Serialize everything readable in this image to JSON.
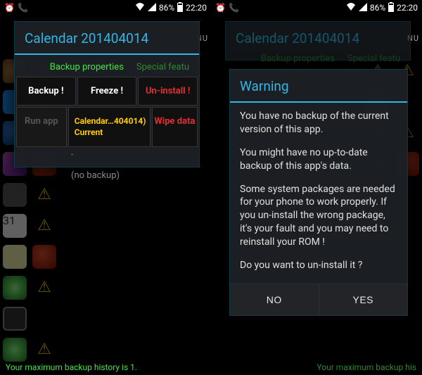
{
  "status": {
    "battery": "86%",
    "time": "22:20"
  },
  "nu_label": "NU",
  "dialog1": {
    "title": "Calendar 201404014",
    "tab_a": "Backup properties",
    "tab_b": "Special featu",
    "btn_backup": "Backup !",
    "btn_freeze": "Freeze !",
    "btn_uninstall": "Un-install !",
    "btn_run": "Run app",
    "current_line1": "Calendar…404014)",
    "current_line2": "Current",
    "btn_wipe": "Wipe data",
    "dash": "-",
    "no_backup": "(no backup)"
  },
  "dialog2": {
    "title": "Calendar 201404014",
    "tab_a": "Backup properties",
    "tab_b": "Special featu",
    "warn_title": "Warning",
    "p1": "You have no backup of the current version of this app.",
    "p2": "You might have no up-to-date backup of this app's data.",
    "p3": "Some system packages are needed for your phone to work properly. If you un-install the wrong package, it's your fault and you may need to reinstall your ROM !",
    "p4": "Do you want to un-install it ?",
    "no": "NO",
    "yes": "YES"
  },
  "footer": "Your maximum backup history is 1.",
  "footer2": "Your maximum backup his"
}
